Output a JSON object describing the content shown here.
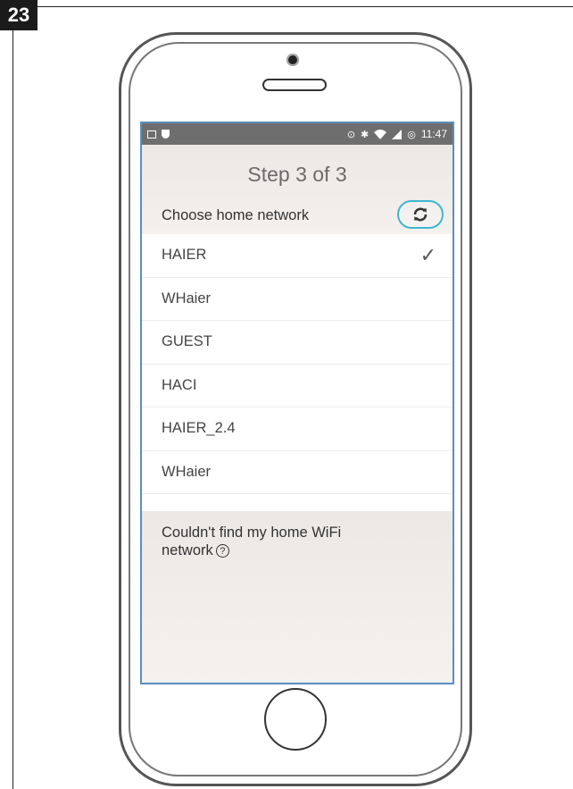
{
  "figure": {
    "step_number": "23"
  },
  "status_bar": {
    "time": "11:47"
  },
  "screen": {
    "title": "Step 3 of 3",
    "choose_label": "Choose home network",
    "networks": [
      {
        "name": "HAIER",
        "selected": true
      },
      {
        "name": "WHaier",
        "selected": false
      },
      {
        "name": "GUEST",
        "selected": false
      },
      {
        "name": "HACI",
        "selected": false
      },
      {
        "name": "HAIER_2.4",
        "selected": false
      },
      {
        "name": "WHaier",
        "selected": false
      }
    ],
    "cant_find_text": "Couldn't find my home WiFi network",
    "help_icon": "?",
    "icons": {
      "refresh": "refresh-icon",
      "check": "checkmark-icon",
      "help": "question-circle-icon"
    },
    "accent_color": "#3fb6cf"
  }
}
